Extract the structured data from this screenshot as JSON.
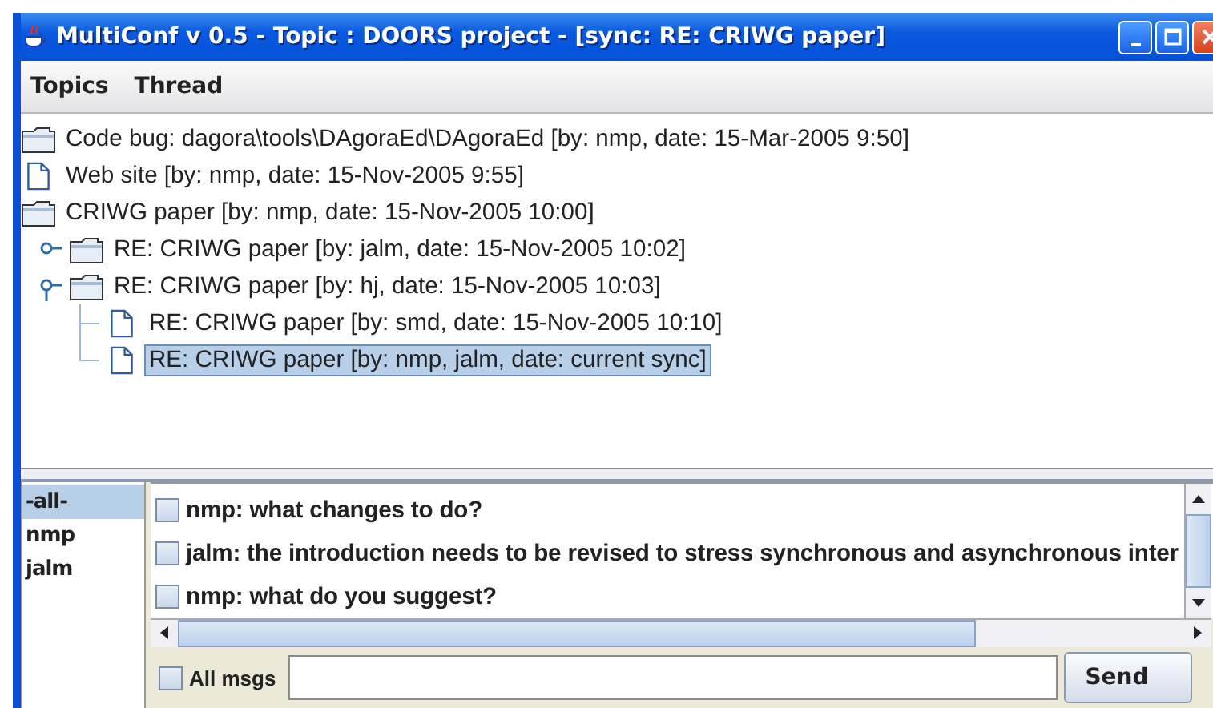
{
  "window": {
    "title": "MultiConf v 0.5 - Topic : DOORS project - [sync: RE: CRIWG paper]"
  },
  "menu": [
    "Topics",
    "Thread"
  ],
  "tree": [
    {
      "kind": "folder",
      "label": "Code bug: dagora\\tools\\DAgoraEd\\DAgoraEd [by: nmp, date: 15-Mar-2005 9:50]",
      "selected": false
    },
    {
      "kind": "file",
      "label": "Web site [by: nmp, date: 15-Nov-2005 9:55]",
      "selected": false
    },
    {
      "kind": "folder",
      "label": "CRIWG paper [by: nmp, date: 15-Nov-2005 10:00]",
      "selected": false,
      "children": [
        {
          "kind": "folder",
          "label": "RE: CRIWG paper [by: jalm, date: 15-Nov-2005 10:02]",
          "selected": false,
          "expanded": false
        },
        {
          "kind": "folder",
          "label": "RE: CRIWG paper [by: hj, date: 15-Nov-2005 10:03]",
          "selected": false,
          "expanded": true,
          "children": [
            {
              "kind": "file",
              "label": "RE: CRIWG paper [by: smd, date: 15-Nov-2005 10:10]",
              "selected": false
            },
            {
              "kind": "file",
              "label": "RE: CRIWG paper [by: nmp, jalm, date: current sync]",
              "selected": true
            }
          ]
        }
      ]
    }
  ],
  "users": [
    {
      "name": "-all-",
      "selected": true
    },
    {
      "name": "nmp",
      "selected": false
    },
    {
      "name": "jalm",
      "selected": false
    }
  ],
  "messages": [
    {
      "text": "nmp: what changes to do?",
      "checked": false
    },
    {
      "text": "jalm: the introduction needs to be revised to stress synchronous and asynchronous inter",
      "checked": false
    },
    {
      "text": "nmp: what do you suggest?",
      "checked": false
    }
  ],
  "all_msgs": {
    "label": "All msgs",
    "checked": false
  },
  "send_button": "Send"
}
